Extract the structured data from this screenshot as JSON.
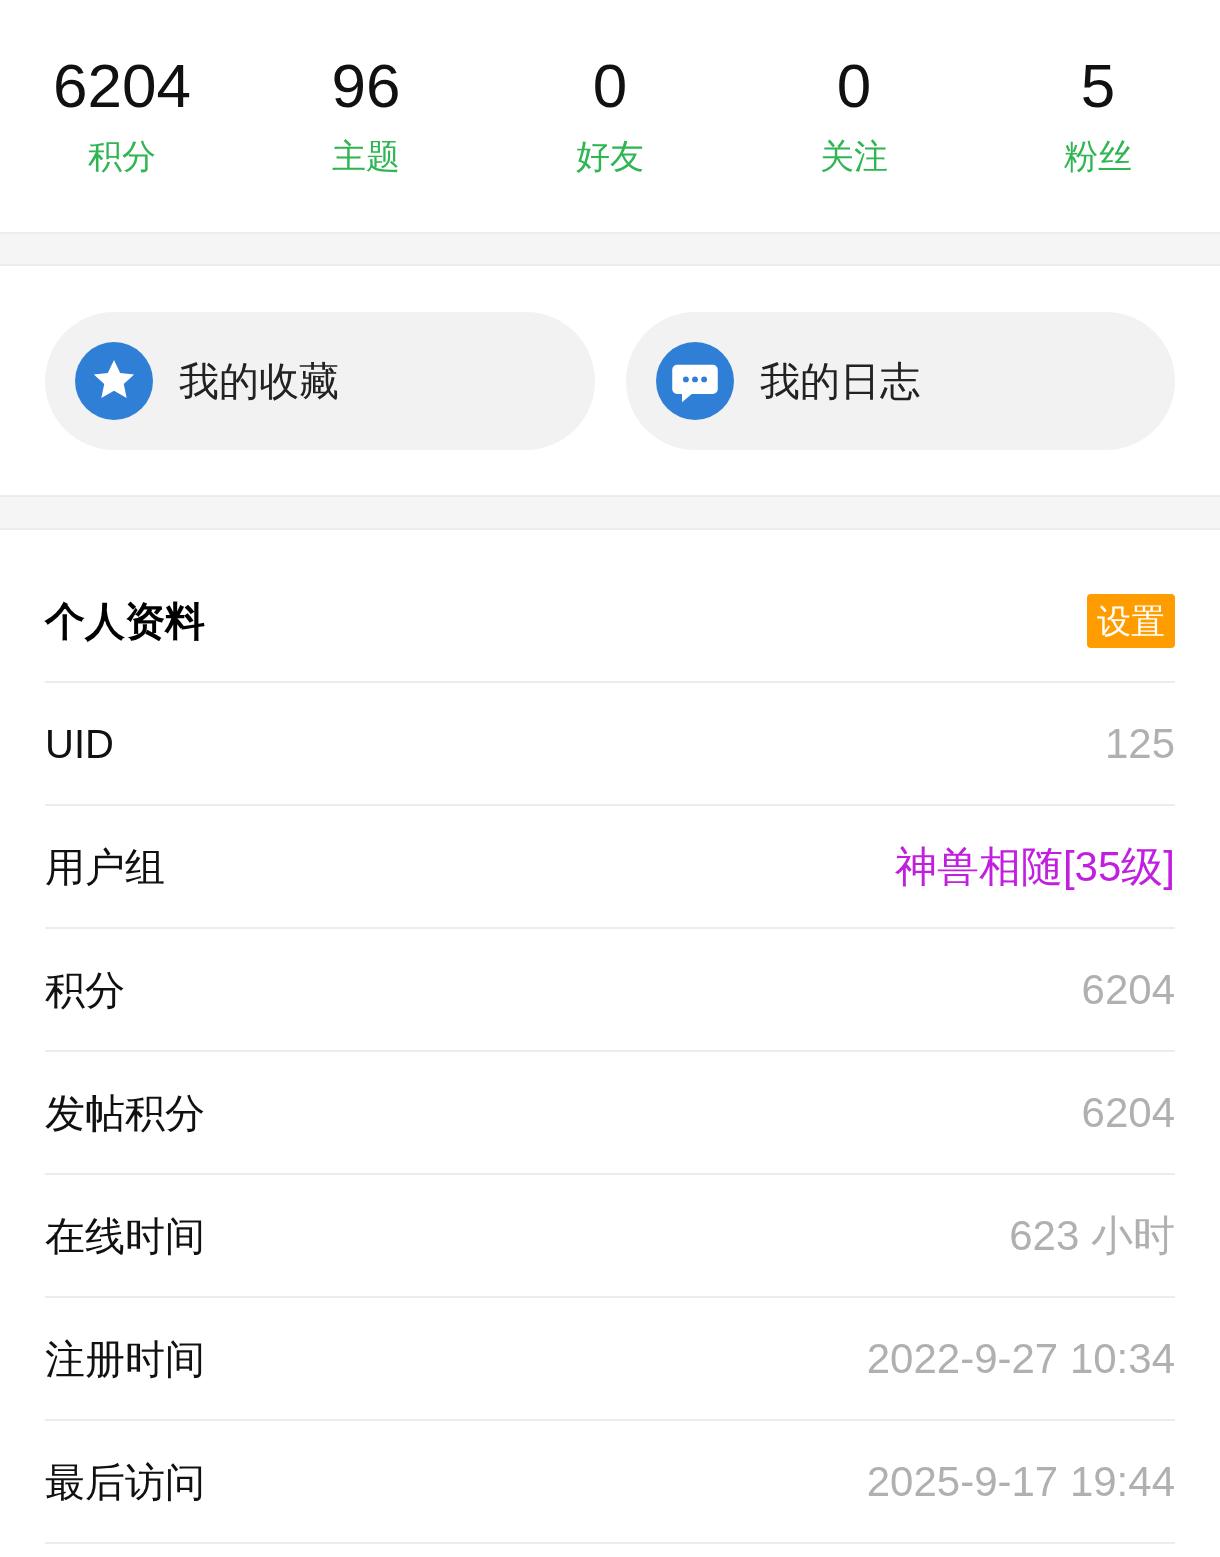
{
  "stats": [
    {
      "value": "6204",
      "label": "积分"
    },
    {
      "value": "96",
      "label": "主题"
    },
    {
      "value": "0",
      "label": "好友"
    },
    {
      "value": "0",
      "label": "关注"
    },
    {
      "value": "5",
      "label": "粉丝"
    }
  ],
  "shortcuts": [
    {
      "kind": "star",
      "label": "我的收藏"
    },
    {
      "kind": "chat",
      "label": "我的日志"
    }
  ],
  "profile": {
    "title": "个人资料",
    "settings_button": "设置",
    "rows": [
      {
        "label": "UID",
        "value": "125",
        "color": "#b0b0b0"
      },
      {
        "label": "用户组",
        "value": "神兽相随[35级]",
        "color": "#c21ee0"
      },
      {
        "label": "积分",
        "value": "6204",
        "color": "#b0b0b0"
      },
      {
        "label": "发帖积分",
        "value": "6204",
        "color": "#b0b0b0"
      },
      {
        "label": "在线时间",
        "value": "623 小时",
        "color": "#b0b0b0"
      },
      {
        "label": "注册时间",
        "value": "2022-9-27 10:34",
        "color": "#b0b0b0"
      },
      {
        "label": "最后访问",
        "value": "2025-9-17 19:44",
        "color": "#b0b0b0"
      }
    ]
  }
}
